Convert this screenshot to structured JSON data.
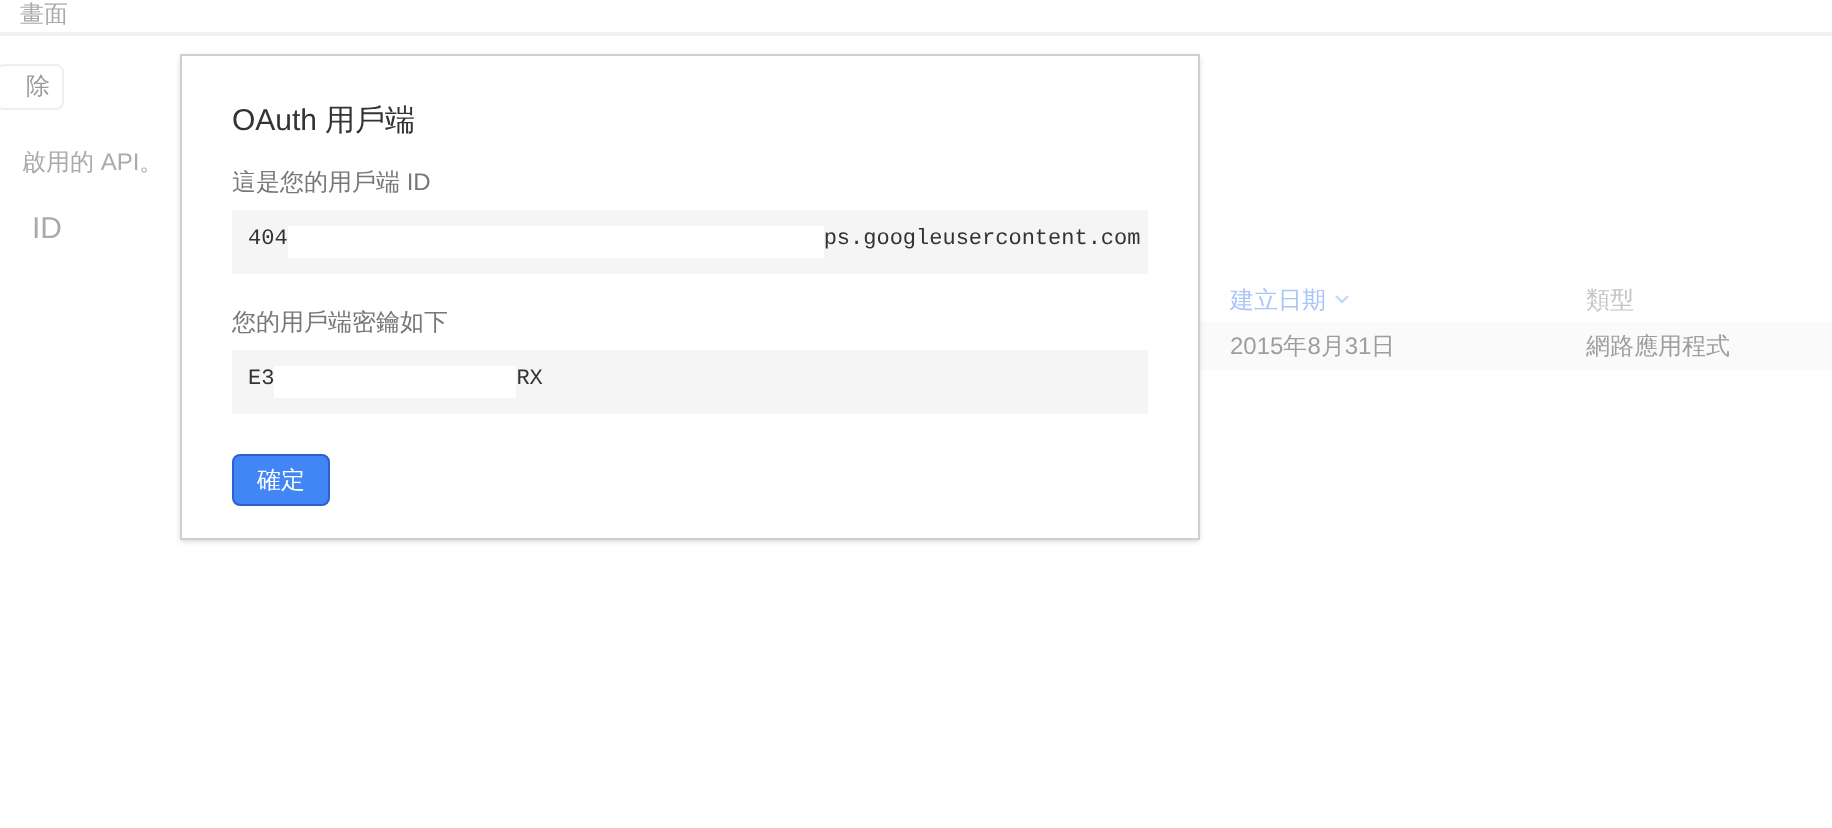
{
  "page": {
    "header_text": "畫面",
    "delete_button": "除",
    "description": "啟用的 API。",
    "section_title": "ID",
    "table": {
      "columns": [
        {
          "label": "建立日期",
          "sorted": true
        },
        {
          "label": "類型",
          "sorted": false
        }
      ],
      "rows": [
        [
          "2015年8月31日",
          "網路應用程式"
        ]
      ]
    }
  },
  "dialog": {
    "title": "OAuth 用戶端",
    "fields": [
      {
        "label": "這是您的用戶端 ID",
        "value_start": "404",
        "value_end": "ps.googleusercontent.com"
      },
      {
        "label": "您的用戶端密鑰如下",
        "value_start": "E3",
        "value_end": "RX"
      }
    ],
    "ok_button": "確定"
  }
}
